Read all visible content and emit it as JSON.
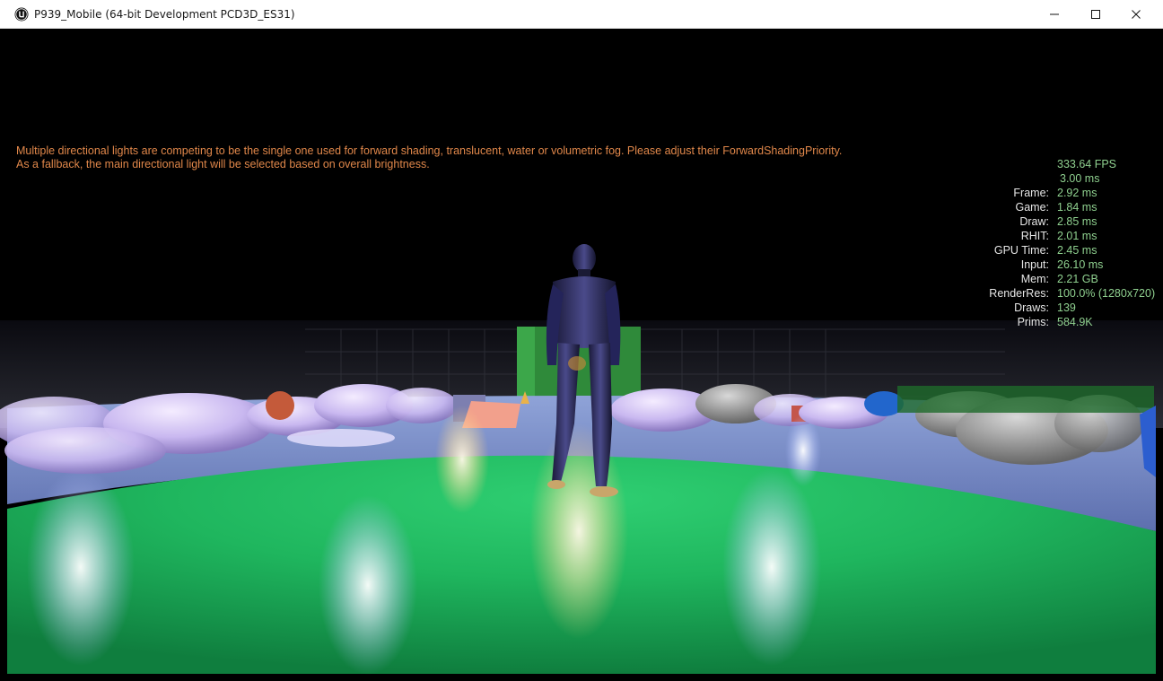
{
  "window": {
    "title": "P939_Mobile (64-bit Development PCD3D_ES31)",
    "logo_icon": "unreal-engine-logo-icon",
    "controls": {
      "minimize_icon": "minimize-icon",
      "maximize_icon": "maximize-icon",
      "close_icon": "close-icon"
    }
  },
  "viewport": {
    "warning_lines": [
      "Multiple directional lights are competing to be the single one used for forward shading, translucent, water or volumetric fog. Please adjust their ForwardShadingPriority.",
      "As a fallback, the main directional light will be selected based on overall brightness."
    ],
    "warning_color": "#e0874a",
    "stats": {
      "fps": "333.64 FPS",
      "frame_ms": "3.00 ms",
      "rows": [
        {
          "label": "Frame:",
          "value": "2.92 ms"
        },
        {
          "label": "Game:",
          "value": "1.84 ms"
        },
        {
          "label": "Draw:",
          "value": "2.85 ms"
        },
        {
          "label": "RHIT:",
          "value": "2.01 ms"
        },
        {
          "label": "GPU Time:",
          "value": "2.45 ms"
        },
        {
          "label": "Input:",
          "value": "26.10 ms"
        },
        {
          "label": "Mem:",
          "value": "2.21 GB"
        },
        {
          "label": "RenderRes:",
          "value": "100.0% (1280x720)"
        },
        {
          "label": "Draws:",
          "value": "139"
        },
        {
          "label": "Prims:",
          "value": "584.9K"
        }
      ],
      "value_color": "#8fd08f"
    }
  }
}
